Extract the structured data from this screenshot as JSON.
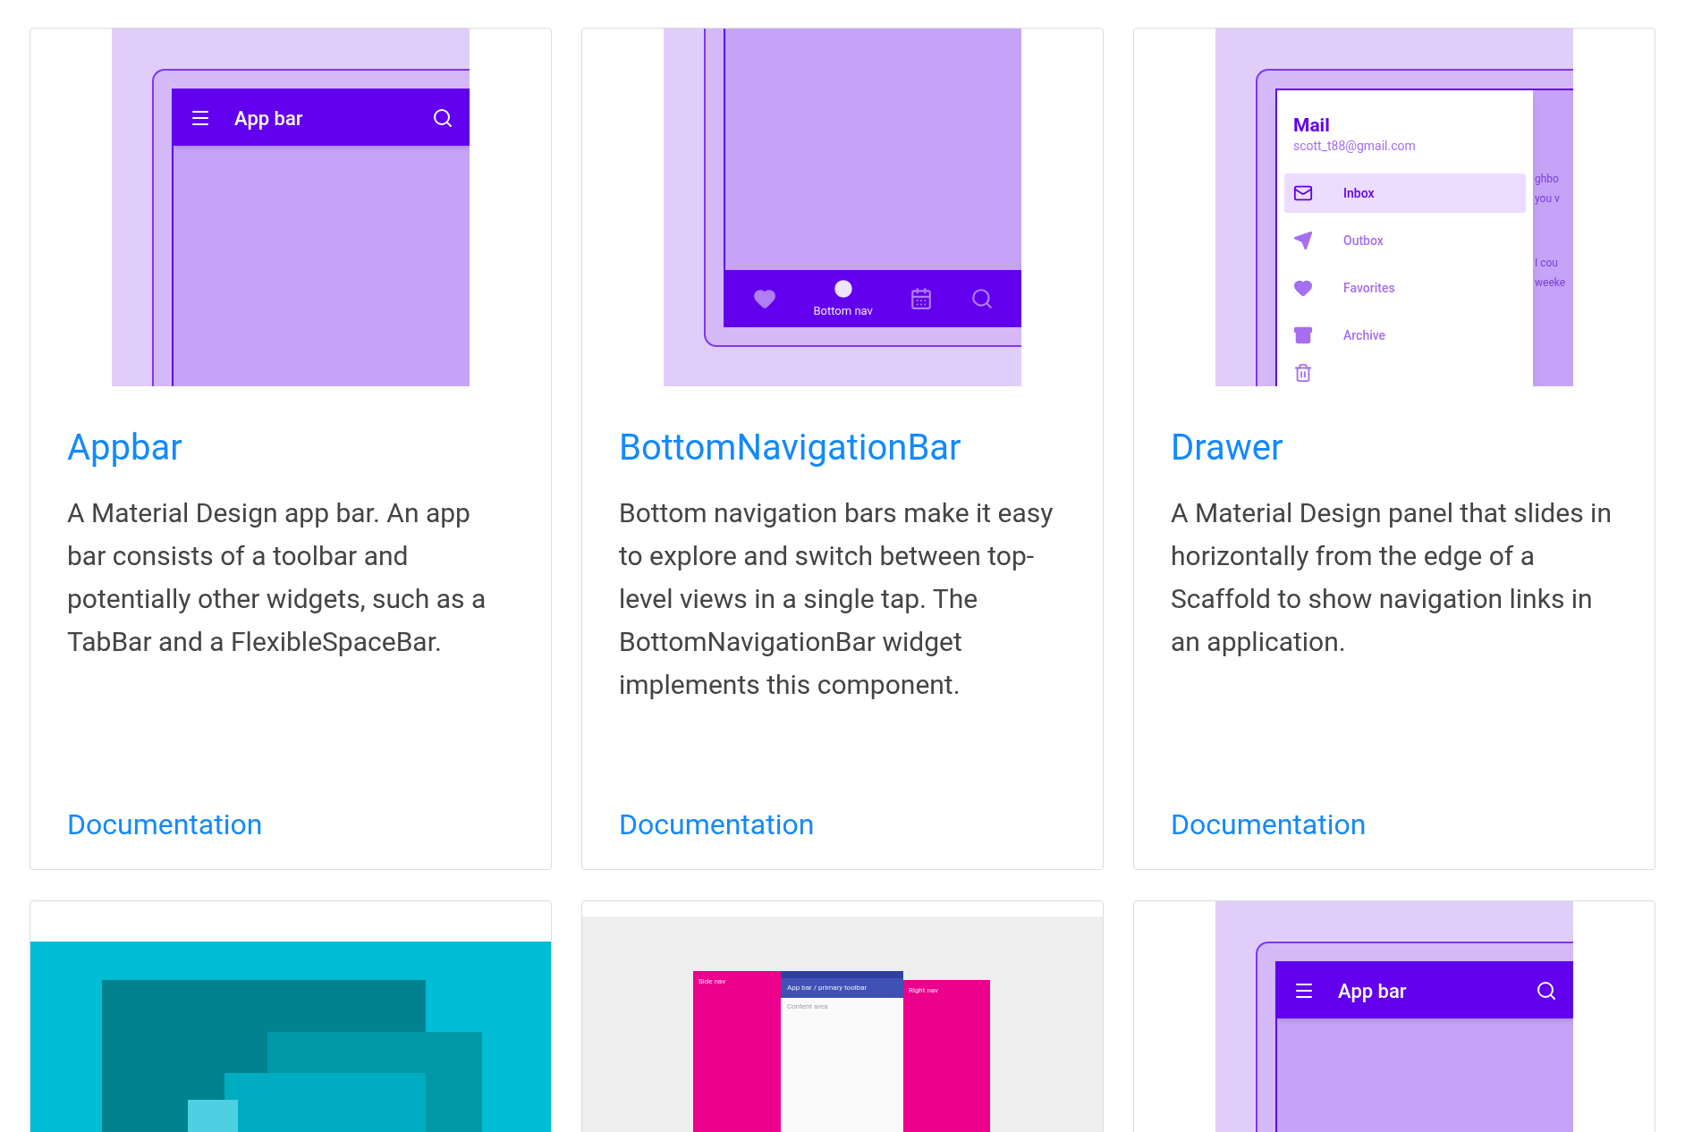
{
  "cards": [
    {
      "kind": "appbar",
      "illustration": {
        "title": "App bar"
      },
      "title": "Appbar",
      "description": "A Material Design app bar. An app bar consists of a toolbar and potentially other widgets, such as a TabBar and a FlexibleSpaceBar.",
      "link": "Documentation"
    },
    {
      "kind": "bottomnav",
      "illustration": {
        "items": [
          {
            "selected": false
          },
          {
            "selected": true,
            "label": "Bottom nav"
          },
          {
            "selected": false
          },
          {
            "selected": false
          }
        ]
      },
      "title": "BottomNavigationBar",
      "description": "Bottom navigation bars make it easy to explore and switch between top-level views in a single tap. The BottomNavigationBar widget implements this component.",
      "link": "Documentation"
    },
    {
      "kind": "drawer",
      "illustration": {
        "heading": "Mail",
        "account": "scott_t88@gmail.com",
        "items": [
          {
            "label": "Inbox",
            "selected": true
          },
          {
            "label": "Outbox",
            "selected": false
          },
          {
            "label": "Favorites",
            "selected": false
          },
          {
            "label": "Archive",
            "selected": false
          }
        ],
        "behind_text": [
          "ghbo",
          "you v",
          "I cou",
          "weeke"
        ]
      },
      "title": "Drawer",
      "description": "A Material Design panel that slides in horizontally from the edge of a Scaffold to show navigation links in an application.",
      "link": "Documentation"
    },
    {
      "kind": "layers"
    },
    {
      "kind": "layout",
      "illustration": {
        "side_nav": "Side nav",
        "app_bar": "App bar / primary toolbar",
        "content": "Content area",
        "right_nav": "Right nav"
      }
    },
    {
      "kind": "appbar-top",
      "illustration": {
        "title": "App bar"
      }
    }
  ]
}
